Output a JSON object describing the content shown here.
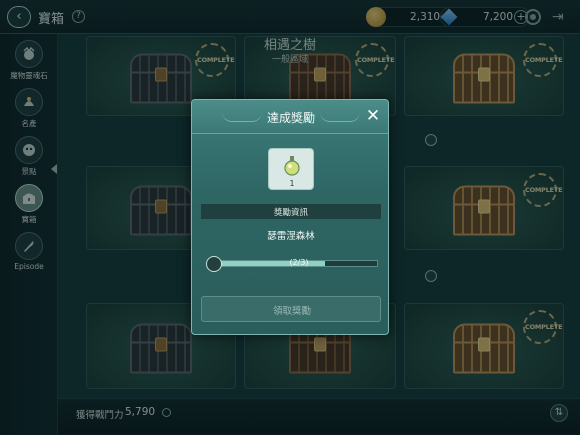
{
  "topbar": {
    "back_icon": "‹",
    "title": "寶箱",
    "help_icon": "?",
    "gold": "2,310K",
    "gems": "7,200",
    "plus": "+"
  },
  "sidebar": {
    "items": [
      {
        "label": "魔物靈魂石",
        "icon": "monster-soul-stone-icon"
      },
      {
        "label": "名產",
        "icon": "specialty-icon"
      },
      {
        "label": "景點",
        "icon": "scenic-spot-icon"
      },
      {
        "label": "寶箱",
        "icon": "treasure-chest-icon",
        "active": true
      },
      {
        "label": "Episode",
        "icon": "quill-icon"
      }
    ]
  },
  "area": {
    "title": "相遇之樹",
    "subtitle": "一般區域"
  },
  "grid": {
    "complete_badge": "COMPLETE"
  },
  "bottom": {
    "power_label": "獲得戰鬥力",
    "power_value": "5,790"
  },
  "modal": {
    "title": "達成獎勵",
    "close": "✕",
    "reward_count": "1",
    "info_label": "獎勵資訊",
    "place_name": "瑟雷涅森林",
    "progress_text": "(2/3)",
    "progress_value": 0.667,
    "claim_label": "領取獎勵"
  },
  "colors": {
    "modal_bg": "#2e6664",
    "progress_fill": "#8fd2c4",
    "gold_coin": "#d4a84a",
    "gem_blue": "#2a74c8"
  }
}
